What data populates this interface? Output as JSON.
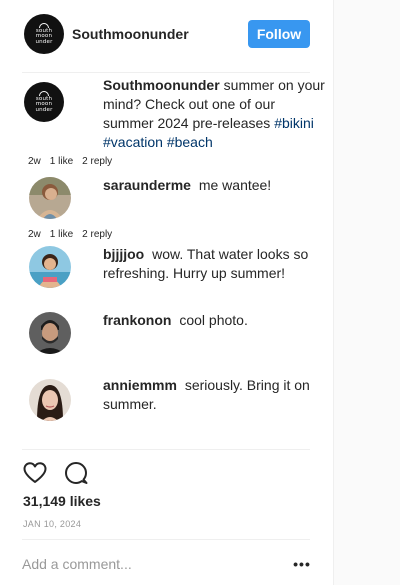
{
  "post": {
    "username": "Southmoonunder",
    "follow_label": "Follow",
    "logo_lines": [
      "south",
      "moon",
      "under"
    ],
    "caption": {
      "author": "Southmoonunder",
      "text": "summer on your mind? Check out one of our summer 2024 pre-releases",
      "tags": [
        "#bikini",
        "#vacation",
        "#beach"
      ]
    },
    "likes": "31,149 likes",
    "date": "JAN 10, 2024",
    "add_comment_placeholder": "Add a comment...",
    "more_label": "•••"
  },
  "comments": [
    {
      "author": "saraunderme",
      "text": "me wantee!",
      "meta": {
        "time": "2w",
        "likes": "1 like",
        "replies": "2 reply"
      }
    },
    {
      "author": "bjjjjoo",
      "text": "wow. That water looks so refreshing. Hurry up summer!"
    },
    {
      "author": "frankonon",
      "text": "cool photo."
    },
    {
      "author": "anniemmm",
      "text": "seriously. Bring it on summer."
    }
  ],
  "caption_meta": {
    "time": "2w",
    "likes": "1 like",
    "replies": "2 reply"
  },
  "icons": {
    "like": "heart-icon",
    "comment": "comment-bubble-icon",
    "more": "more-options-icon"
  },
  "colors": {
    "follow_button": "#3897f0",
    "hashtag": "#003569",
    "muted": "#999999",
    "text": "#262626"
  }
}
